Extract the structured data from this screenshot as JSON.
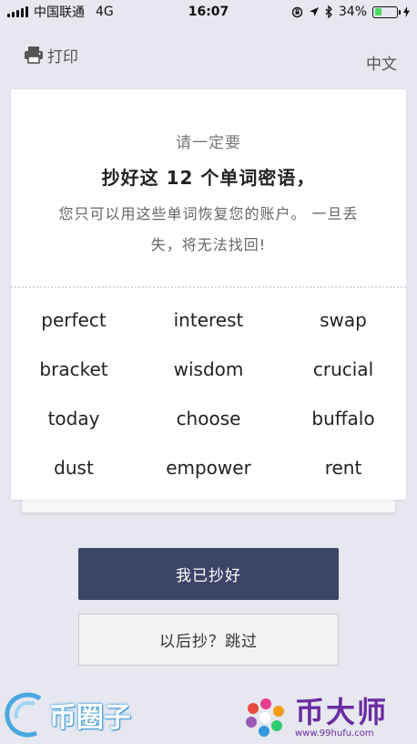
{
  "status_bar": {
    "carrier": "中国联通",
    "network": "4G",
    "time": "16:07",
    "battery_percent": "34%",
    "battery_level": 0.34,
    "battery_color": "#4cd964"
  },
  "topnav": {
    "print_label": "打印",
    "language_label": "中文"
  },
  "card": {
    "subtitle": "请一定要",
    "title": "抄好这 12 个单词密语，",
    "description": "您只可以用这些单词恢复您的账户。 一旦丢失，将无法找回!",
    "words": [
      "perfect",
      "interest",
      "swap",
      "bracket",
      "wisdom",
      "crucial",
      "today",
      "choose",
      "buffalo",
      "dust",
      "empower",
      "rent"
    ]
  },
  "actions": {
    "confirm_label": "我已抄好",
    "skip_label": "以后抄？跳过"
  },
  "watermarks": {
    "left_text": "币圈子",
    "right_text": "币大师",
    "right_url": "www.99hufu.com"
  },
  "colors": {
    "background": "#e6e7ef",
    "primary_button": "#3c4567",
    "brand_purple": "#6a2ca0"
  }
}
